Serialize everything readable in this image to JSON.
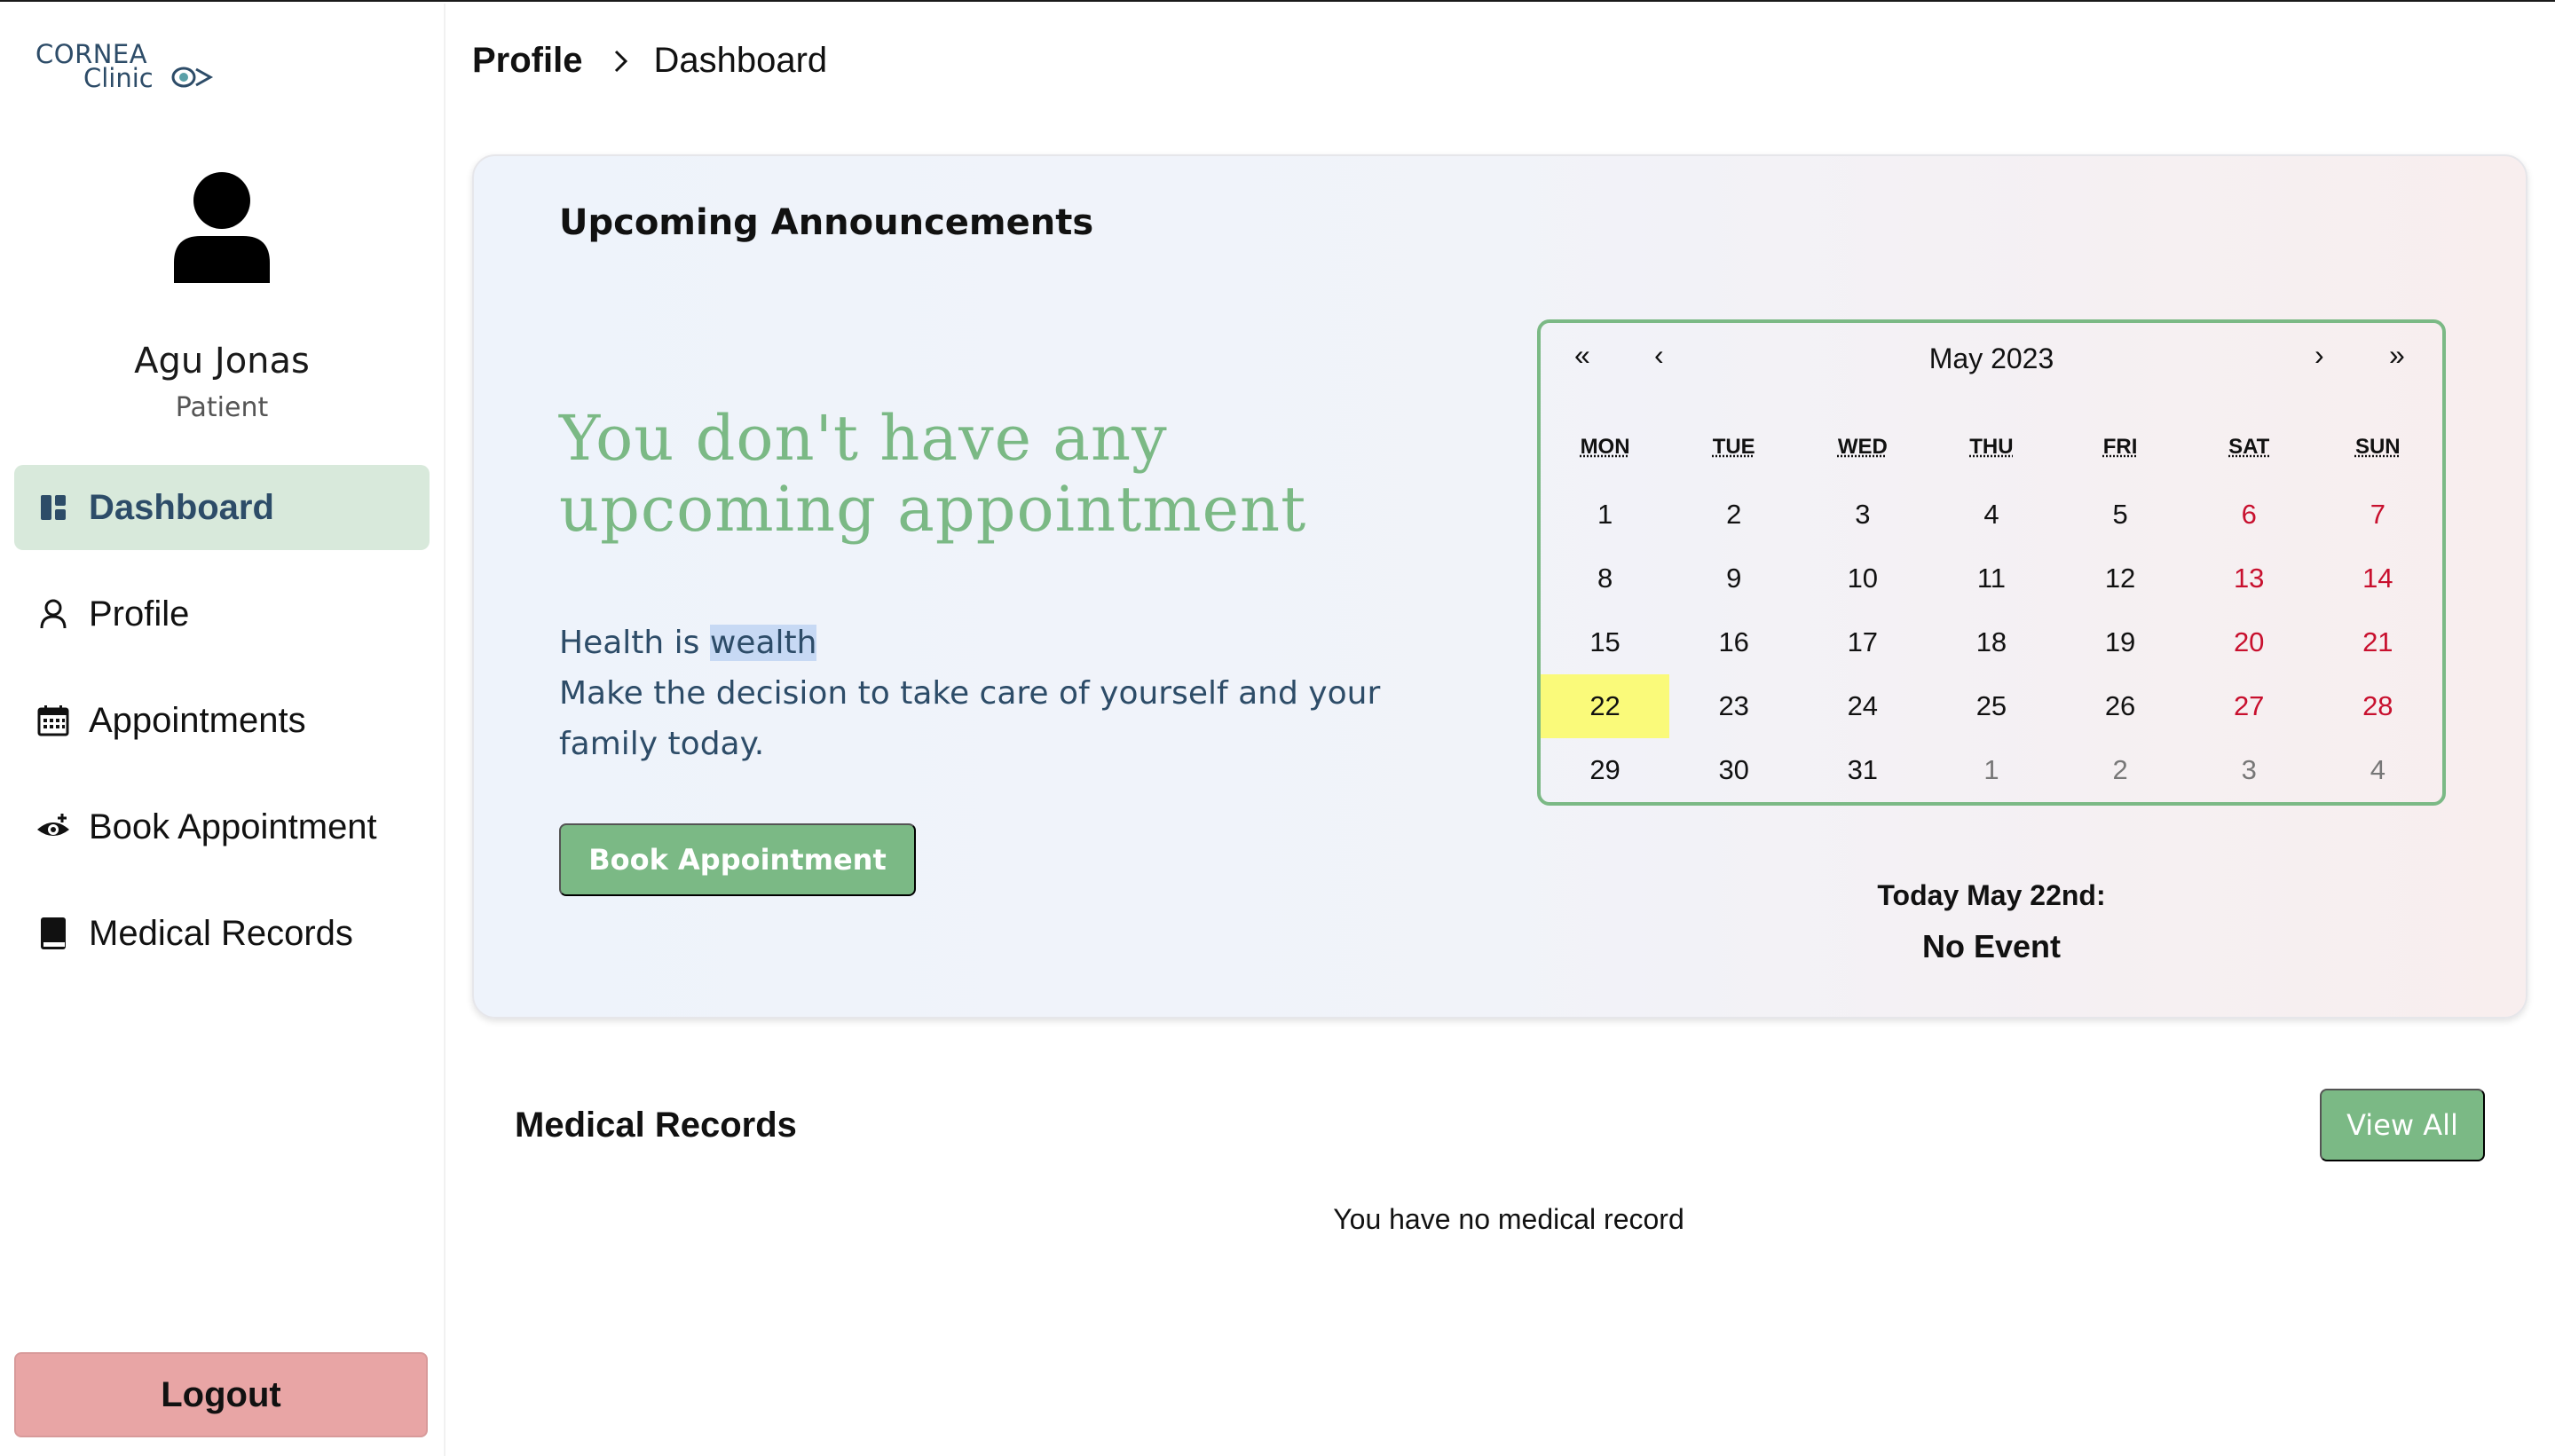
{
  "brand": {
    "line1": "CORNEA",
    "line2": "Clinic"
  },
  "user": {
    "name": "Agu Jonas",
    "role": "Patient"
  },
  "nav": [
    {
      "label": "Dashboard",
      "icon": "dashboard-icon",
      "active": true
    },
    {
      "label": "Profile",
      "icon": "user-icon"
    },
    {
      "label": "Appointments",
      "icon": "calendar-icon"
    },
    {
      "label": "Book Appointment",
      "icon": "eye-add-icon"
    },
    {
      "label": "Medical Records",
      "icon": "book-icon"
    }
  ],
  "logout_label": "Logout",
  "breadcrumb": {
    "parent": "Profile",
    "separator_icon": "chevron-right-icon",
    "current": "Dashboard"
  },
  "announcements": {
    "title": "Upcoming Announcements",
    "headline": "You don't have any upcoming appointment",
    "quote_prefix": "Health is ",
    "quote_highlight": "wealth",
    "quote_line2": "Make the decision to take care of yourself and your family today.",
    "book_button": "Book Appointment"
  },
  "calendar": {
    "month_label": "May 2023",
    "nav": {
      "prev_year": "«",
      "prev_month": "‹",
      "next_month": "›",
      "next_year": "»"
    },
    "weekdays": [
      "MON",
      "TUE",
      "WED",
      "THU",
      "FRI",
      "SAT",
      "SUN"
    ],
    "weeks": [
      [
        "1",
        "2",
        "3",
        "4",
        "5",
        "6",
        "7"
      ],
      [
        "8",
        "9",
        "10",
        "11",
        "12",
        "13",
        "14"
      ],
      [
        "15",
        "16",
        "17",
        "18",
        "19",
        "20",
        "21"
      ],
      [
        "22",
        "23",
        "24",
        "25",
        "26",
        "27",
        "28"
      ],
      [
        "29",
        "30",
        "31",
        "1",
        "2",
        "3",
        "4"
      ]
    ],
    "today": "22",
    "colors": {
      "weekend": "#c8102e",
      "today_bg": "#fafa7a",
      "border": "#7bb985"
    }
  },
  "today_info": {
    "label": "Today May 22nd:",
    "event": "No Event"
  },
  "medical_records": {
    "title": "Medical Records",
    "view_all": "View All",
    "empty": "You have no medical record"
  },
  "colors": {
    "accent": "#7bb985",
    "active_nav_bg": "#d8e9db",
    "logout_bg": "#e8a5a5",
    "navy": "#2d4c68"
  }
}
